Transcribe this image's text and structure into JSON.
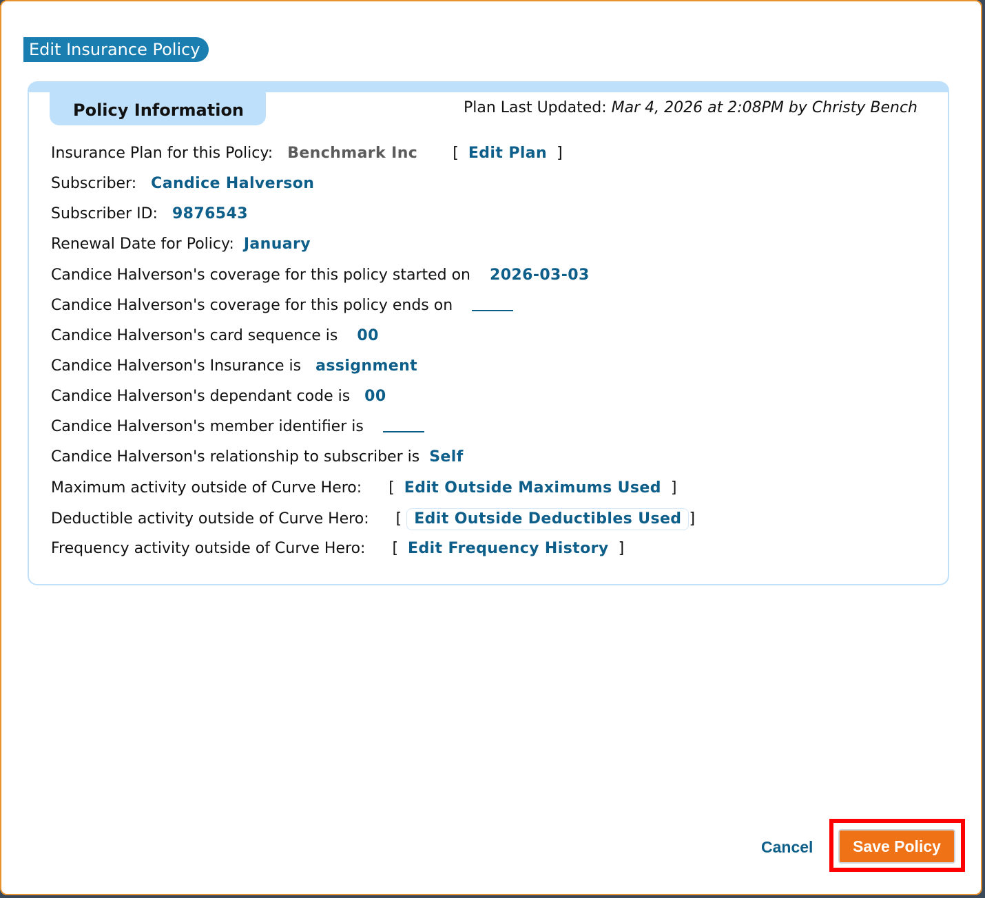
{
  "dialog": {
    "title": "Edit Insurance Policy"
  },
  "panel": {
    "tab_label": "Policy Information",
    "updated_label": "Plan Last Updated:",
    "updated_value": "Mar 4, 2026 at 2:08PM by Christy Bench"
  },
  "fields": {
    "plan_label": "Insurance Plan for this Policy:",
    "plan_value": "Benchmark Inc",
    "edit_plan_link": "Edit Plan",
    "subscriber_label": "Subscriber:",
    "subscriber_value": "Candice Halverson",
    "subscriber_id_label": "Subscriber ID:",
    "subscriber_id_value": "9876543",
    "renewal_label": "Renewal Date for Policy:",
    "renewal_value": "January",
    "coverage_start_label": "Candice Halverson's coverage for this policy started on",
    "coverage_start_value": "2026-03-03",
    "coverage_end_label": "Candice Halverson's coverage for this policy ends on",
    "coverage_end_value": "",
    "card_sequence_label": "Candice Halverson's card sequence is",
    "card_sequence_value": "00",
    "insurance_type_label": "Candice Halverson's Insurance is",
    "insurance_type_value": "assignment",
    "dependant_code_label": "Candice Halverson's dependant code is",
    "dependant_code_value": "00",
    "member_identifier_label": "Candice Halverson's member identifier is",
    "member_identifier_value": "",
    "relationship_label": "Candice Halverson's relationship to subscriber is",
    "relationship_value": "Self",
    "max_activity_label": "Maximum activity outside of Curve Hero:",
    "max_activity_link": "Edit Outside Maximums Used",
    "deductible_activity_label": "Deductible activity outside of Curve Hero:",
    "deductible_activity_link": "Edit Outside Deductibles Used",
    "frequency_activity_label": "Frequency activity outside of Curve Hero:",
    "frequency_activity_link": "Edit Frequency History"
  },
  "footer": {
    "cancel_label": "Cancel",
    "save_label": "Save Policy"
  },
  "colors": {
    "title_bg": "#1a7fb0",
    "panel_border": "#bfe0fb",
    "link": "#0e5e8a",
    "save_button": "#f07217",
    "highlight_box": "#ff0000",
    "dialog_border": "#e8922d"
  }
}
